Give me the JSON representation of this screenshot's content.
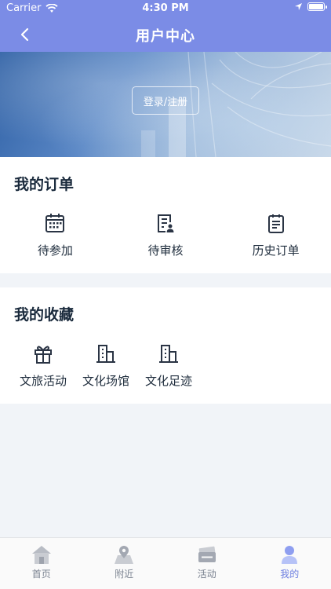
{
  "status_bar": {
    "carrier": "Carrier",
    "time": "4:30 PM"
  },
  "nav": {
    "title": "用户中心"
  },
  "hero": {
    "login_label": "登录/注册"
  },
  "orders": {
    "title": "我的订单",
    "items": [
      {
        "label": "待参加",
        "icon": "calendar-icon"
      },
      {
        "label": "待审核",
        "icon": "review-document-icon"
      },
      {
        "label": "历史订单",
        "icon": "history-list-icon"
      }
    ]
  },
  "favorites": {
    "title": "我的收藏",
    "items": [
      {
        "label": "文旅活动",
        "icon": "gift-icon"
      },
      {
        "label": "文化场馆",
        "icon": "building-icon"
      },
      {
        "label": "文化足迹",
        "icon": "building-icon"
      }
    ]
  },
  "tabbar": {
    "items": [
      {
        "label": "首页",
        "icon": "home-icon",
        "active": false
      },
      {
        "label": "附近",
        "icon": "map-pin-icon",
        "active": false
      },
      {
        "label": "活动",
        "icon": "ticket-icon",
        "active": false
      },
      {
        "label": "我的",
        "icon": "user-icon",
        "active": true
      }
    ]
  },
  "colors": {
    "nav_background": "#7b8ce6",
    "active_tab": "#6d7fe0",
    "icon_stroke": "#2a3444"
  }
}
